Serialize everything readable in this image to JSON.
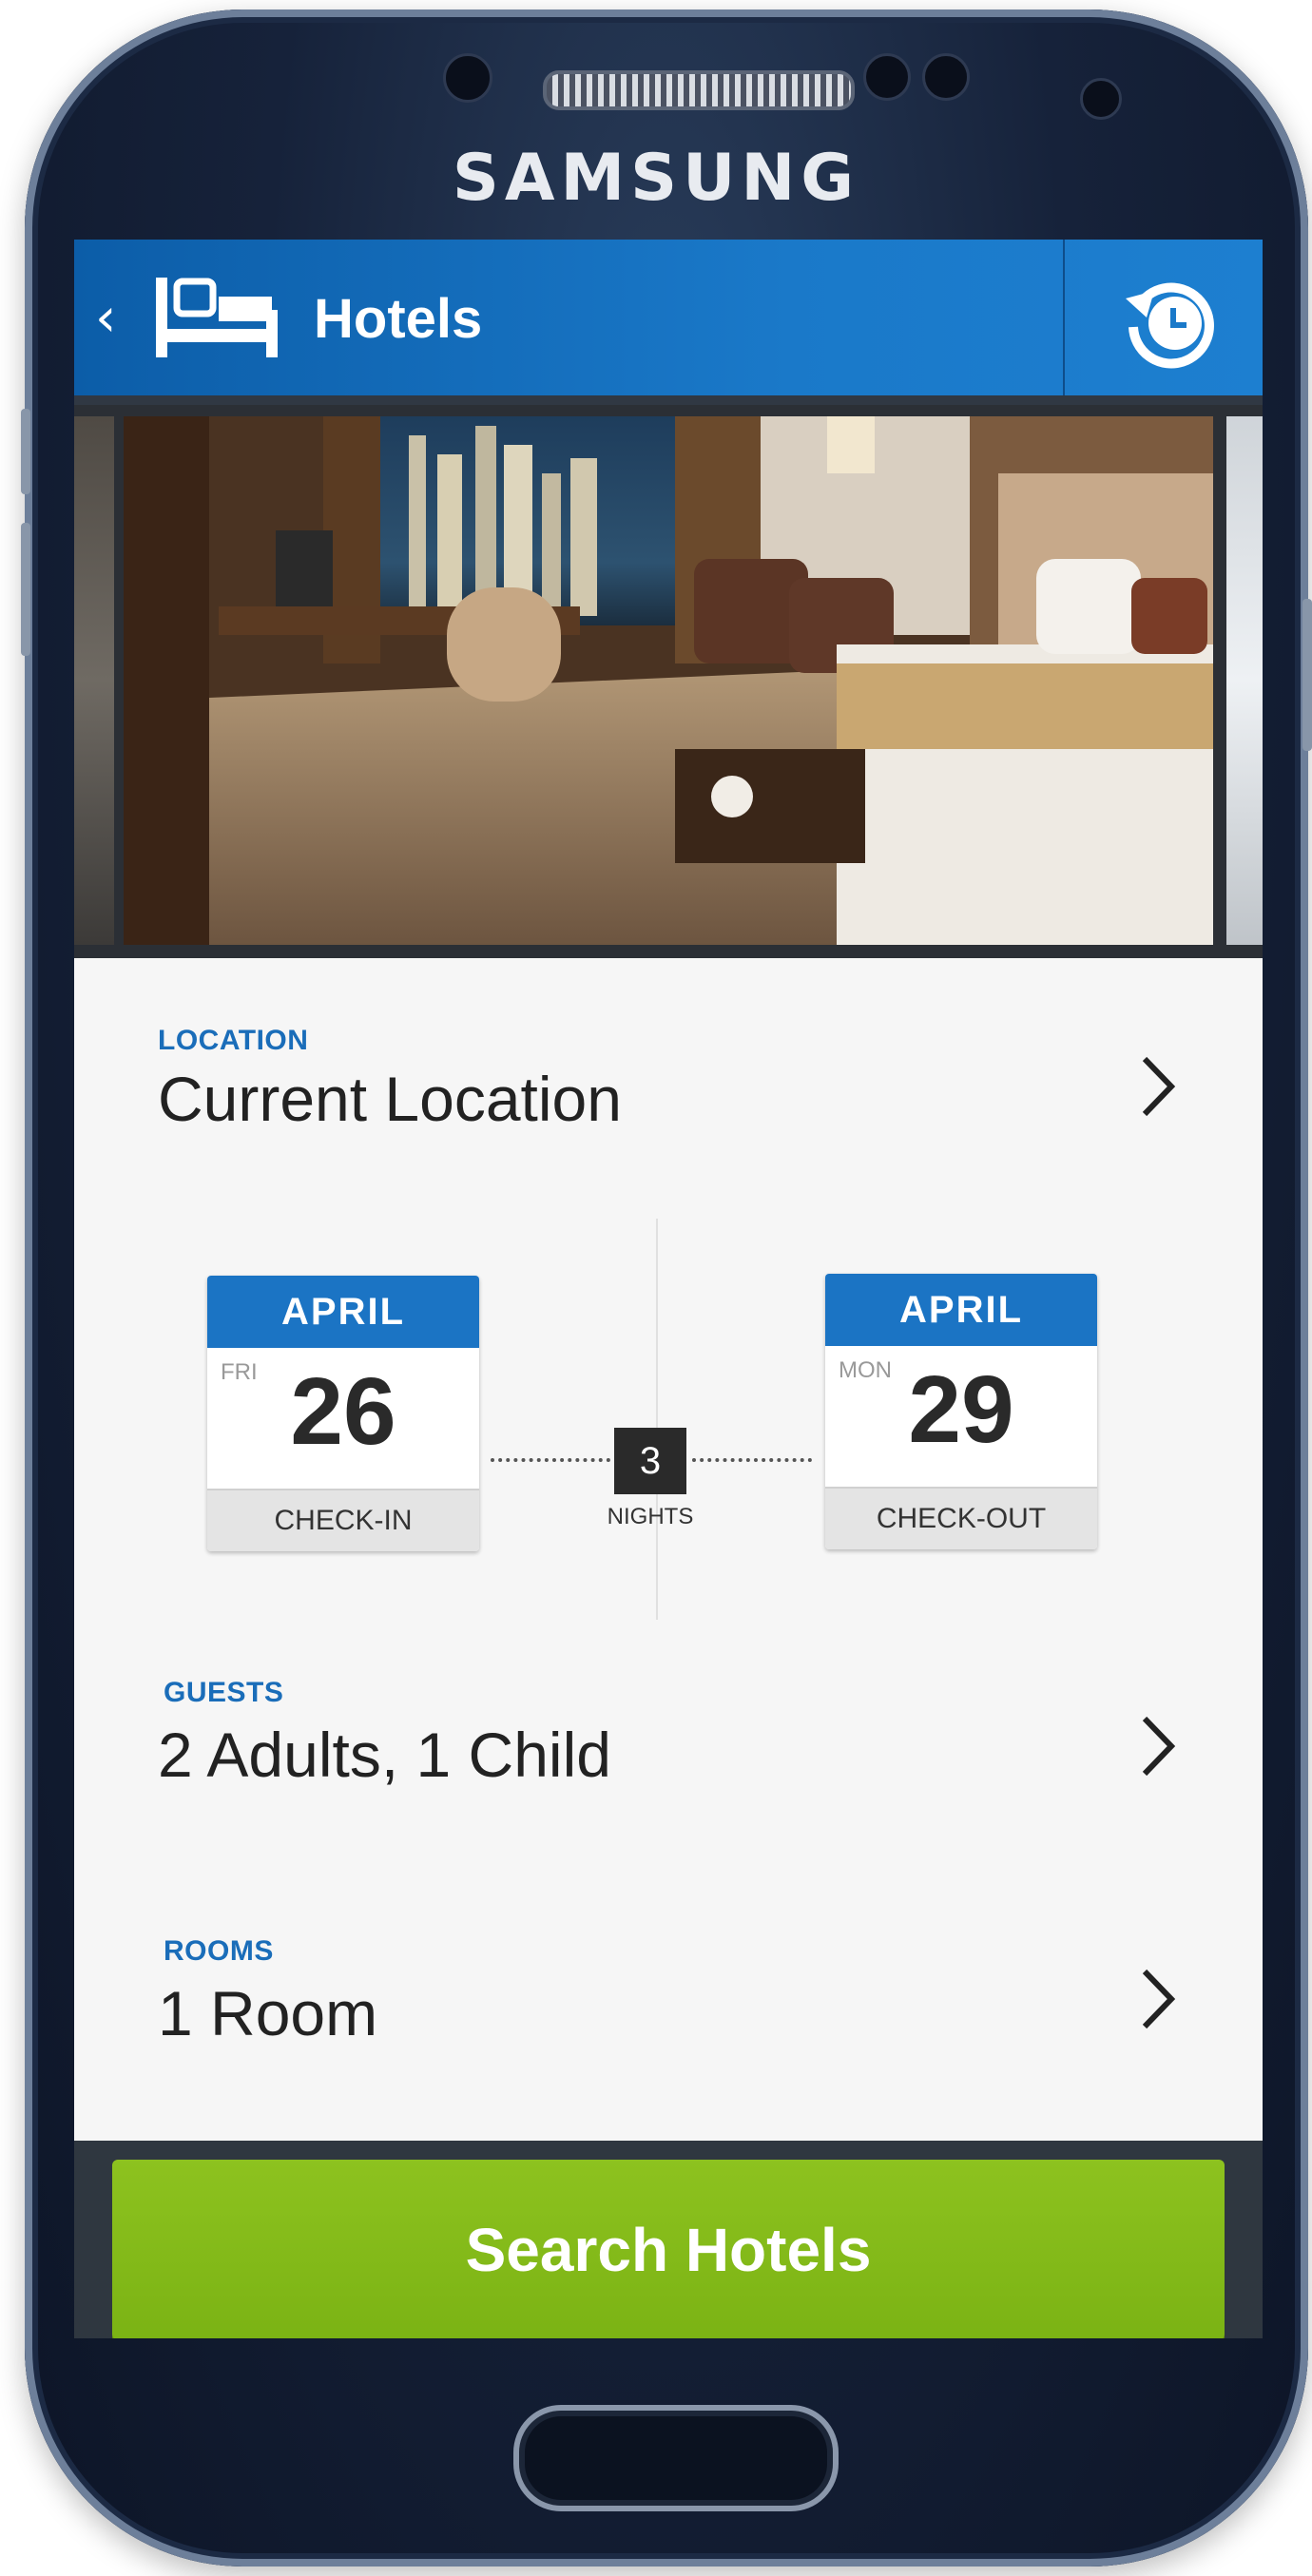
{
  "device": {
    "brand": "SAMSUNG"
  },
  "appbar": {
    "title": "Hotels"
  },
  "location": {
    "label": "LOCATION",
    "value": "Current Location"
  },
  "dates": {
    "checkin": {
      "month": "APRIL",
      "dow": "FRI",
      "day": "26",
      "label": "CHECK-IN"
    },
    "checkout": {
      "month": "APRIL",
      "dow": "MON",
      "day": "29",
      "label": "CHECK-OUT"
    },
    "nights": {
      "count": "3",
      "label": "NIGHTS"
    }
  },
  "guests": {
    "label": "GUESTS",
    "value": "2 Adults, 1 Child"
  },
  "rooms": {
    "label": "ROOMS",
    "value": "1 Room"
  },
  "search": {
    "label": "Search Hotels"
  },
  "colors": {
    "accent": "#1b74c4",
    "cta": "#7bb314",
    "appbar": "#0c5da8"
  }
}
